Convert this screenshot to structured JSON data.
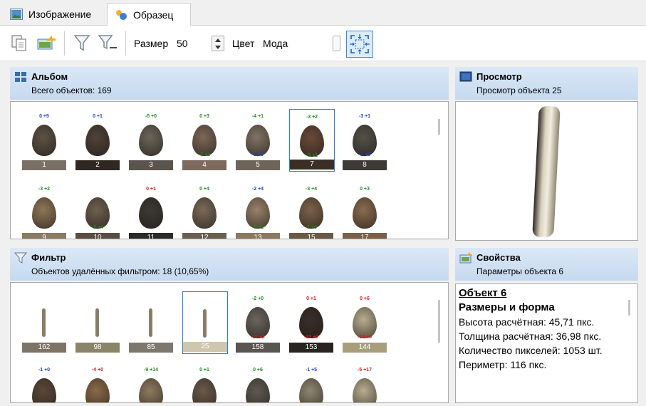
{
  "tabs": [
    {
      "label": "Изображение",
      "icon": "image-icon"
    },
    {
      "label": "Образец",
      "icon": "sample-icon",
      "active": true
    }
  ],
  "toolbar": {
    "size_label": "Размер",
    "size_value": "50",
    "color_label": "Цвет",
    "color_value": "Мода"
  },
  "album": {
    "title": "Альбом",
    "subtitle": "Всего объектов: 169",
    "row1": [
      {
        "top": "0 +5",
        "top_color": "blue",
        "bottom": "",
        "num": "1",
        "bar": "#7a7066",
        "shape": "#5d5244"
      },
      {
        "top": "0 +1",
        "top_color": "blue",
        "bottom": "",
        "num": "2",
        "bar": "#2f2822",
        "shape": "#4e4238"
      },
      {
        "top": "-5 +0",
        "top_color": "green",
        "bottom": "",
        "num": "3",
        "bar": "#5a544c",
        "shape": "#6b6458"
      },
      {
        "top": "0 +3",
        "top_color": "green",
        "bottom": "-3 +1",
        "bottom_color": "green",
        "num": "4",
        "bar": "#7c6a5c",
        "shape": "#7d6758"
      },
      {
        "top": "-4 +1",
        "top_color": "green",
        "bottom": "-2 +0",
        "bottom_color": "blue",
        "num": "5",
        "bar": "#6e655a",
        "shape": "#807464"
      },
      {
        "top": "-3 +2",
        "top_color": "green",
        "bottom": "-3 +1",
        "bottom_color": "green",
        "num": "7",
        "bar": "#3a2f27",
        "shape": "#6a4a38",
        "selected": true
      },
      {
        "top": "-3 +1",
        "top_color": "blue",
        "bottom": "-2 +0",
        "bottom_color": "blue",
        "num": "8",
        "bar": "#3d3a35",
        "shape": "#53504a"
      }
    ],
    "row2": [
      {
        "top": "-3 +2",
        "top_color": "green",
        "bottom": "",
        "num": "9",
        "bar": "#8b7a62",
        "shape": "#8f7758"
      },
      {
        "top": "",
        "top_color": "green",
        "bottom": "-2 +4",
        "bottom_color": "green",
        "num": "10",
        "bar": "#5a4e40",
        "shape": "#6e6050"
      },
      {
        "top": "0 +1",
        "top_color": "red",
        "bottom": "",
        "num": "11",
        "bar": "#2a2a28",
        "shape": "#3c3a36"
      },
      {
        "top": "0 +4",
        "top_color": "green",
        "bottom": "",
        "num": "12",
        "bar": "#6a5e50",
        "shape": "#7a6a58"
      },
      {
        "top": "-2 +4",
        "top_color": "blue",
        "bottom": "-3 +1",
        "bottom_color": "green",
        "num": "13",
        "bar": "#8c7a60",
        "shape": "#98826a"
      },
      {
        "top": "-3 +4",
        "top_color": "green",
        "bottom": "-1 +0",
        "bottom_color": "green",
        "num": "15",
        "bar": "#6b5846",
        "shape": "#7c624a"
      },
      {
        "top": "0 +3",
        "top_color": "green",
        "bottom": "",
        "num": "17",
        "bar": "#7a6048",
        "shape": "#8a6c50"
      }
    ]
  },
  "preview": {
    "title": "Просмотр",
    "subtitle": "Просмотр объекта 25"
  },
  "filter": {
    "title": "Фильтр",
    "subtitle": "Объектов удалённых фильтром: 18 (10,65%)",
    "row1": [
      {
        "top": "",
        "top_color": "green",
        "bottom": "",
        "num": "162",
        "bar": "#7e7466",
        "kind": "stick"
      },
      {
        "top": "",
        "top_color": "green",
        "bottom": "",
        "num": "98",
        "bar": "#8a8468",
        "kind": "stick"
      },
      {
        "top": "",
        "top_color": "green",
        "bottom": "",
        "num": "85",
        "bar": "#7c786e",
        "kind": "stick"
      },
      {
        "top": "",
        "top_color": "green",
        "bottom": "",
        "num": "25",
        "bar": "#cfc6ae",
        "kind": "stick",
        "selected": true
      },
      {
        "top": "-2 +0",
        "top_color": "green",
        "bottom": "-11 +2",
        "bottom_color": "red",
        "num": "158",
        "bar": "#595550",
        "kind": "shape",
        "shape": "#6a665e"
      },
      {
        "top": "0 +1",
        "top_color": "red",
        "bottom": "-13 +0",
        "bottom_color": "red",
        "num": "153",
        "bar": "#2a2420",
        "kind": "shape",
        "shape": "#3a2e28"
      },
      {
        "top": "0 +6",
        "top_color": "red",
        "bottom": "-14 +0",
        "bottom_color": "red",
        "num": "144",
        "bar": "#a89e7c",
        "kind": "shape",
        "shape": "#b8ad90"
      }
    ],
    "row2": [
      {
        "top": "-1 +0",
        "top_color": "blue",
        "num": "",
        "bar": "",
        "kind": "shape",
        "shape": "#5a4838"
      },
      {
        "top": "-4 +0",
        "top_color": "red",
        "num": "",
        "bar": "",
        "kind": "shape",
        "shape": "#8a6a4a"
      },
      {
        "top": "-9 +14",
        "top_color": "green",
        "num": "",
        "bar": "",
        "kind": "shape",
        "shape": "#8e7a60"
      },
      {
        "top": "0 +1",
        "top_color": "green",
        "num": "",
        "bar": "",
        "kind": "shape",
        "shape": "#6a5a48"
      },
      {
        "top": "0 +6",
        "top_color": "green",
        "num": "",
        "bar": "",
        "kind": "shape",
        "shape": "#5e5a52"
      },
      {
        "top": "-1 +5",
        "top_color": "blue",
        "num": "",
        "bar": "",
        "kind": "shape",
        "shape": "#8e8672"
      },
      {
        "top": "-5 +17",
        "top_color": "red",
        "num": "",
        "bar": "",
        "kind": "shape",
        "shape": "#b8ac90"
      }
    ]
  },
  "properties": {
    "title": "Свойства",
    "subtitle": "Параметры объекта 6",
    "object_title": "Объект 6",
    "section": "Размеры и форма",
    "lines": [
      "Высота расчётная: 45,71 пкс.",
      "Толщина расчётная: 36,98 пкс.",
      "Количество пикселей: 1053 шт.",
      "Периметр: 116 пкс."
    ]
  }
}
